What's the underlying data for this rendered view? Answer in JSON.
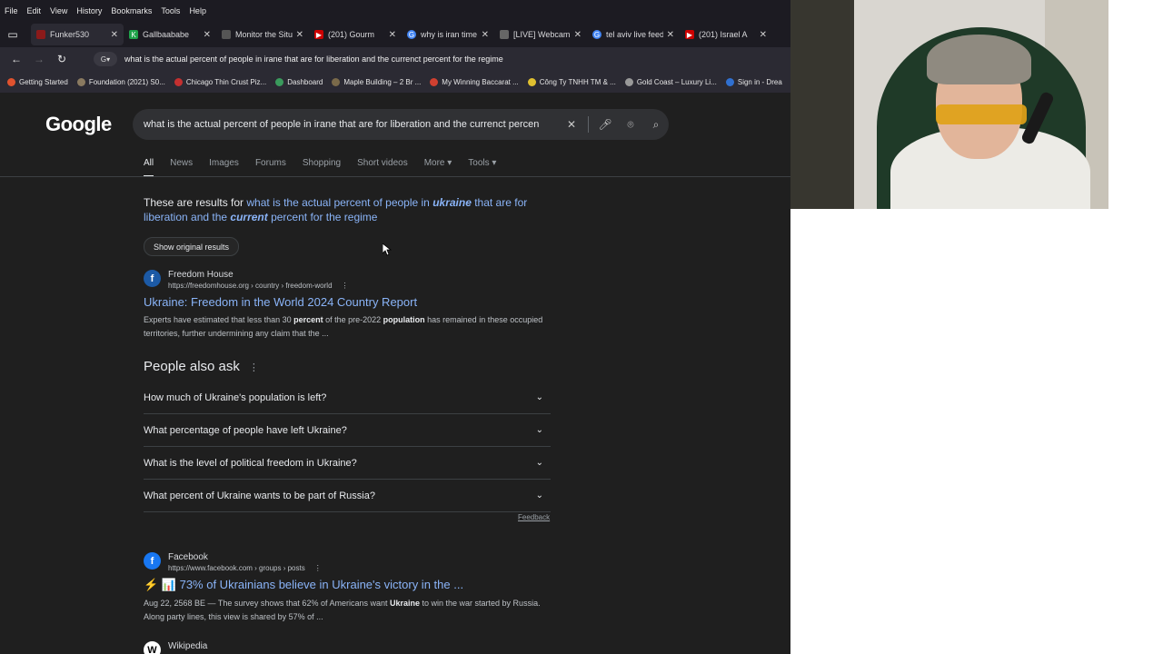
{
  "menu": [
    "File",
    "Edit",
    "View",
    "History",
    "Bookmarks",
    "Tools",
    "Help"
  ],
  "tabs": [
    {
      "title": "Funker530",
      "color": "#8b1a1a",
      "icon": "F"
    },
    {
      "title": "Gallbaababe",
      "color": "#1fa34a",
      "icon": "K"
    },
    {
      "title": "Monitor the Situa",
      "color": "#555555",
      "icon": "◉"
    },
    {
      "title": "(201) Gourm",
      "color": "#cc0000",
      "icon": "▶"
    },
    {
      "title": "why is iran time",
      "color": "#4285f4",
      "icon": "G"
    },
    {
      "title": "[LIVE] Webcam",
      "color": "#666666",
      "icon": "▦"
    },
    {
      "title": "tel aviv live feed",
      "color": "#4285f4",
      "icon": "G"
    },
    {
      "title": "(201) Israel A",
      "color": "#cc0000",
      "icon": "▶"
    }
  ],
  "url": "what is the actual percent of people in irane that are for liberation and the currenct percent for the regime",
  "bookmarks": [
    {
      "label": "Getting Started",
      "color": "#e0522e"
    },
    {
      "label": "Foundation (2021) S0...",
      "color": "#8a7a60"
    },
    {
      "label": "Chicago Thin Crust Piz...",
      "color": "#c43030"
    },
    {
      "label": "Dashboard",
      "color": "#3a9a5c"
    },
    {
      "label": "Maple Building – 2 Br ...",
      "color": "#7a6a4a"
    },
    {
      "label": "My Winning Baccarat ...",
      "color": "#d04030"
    },
    {
      "label": "Công Ty TNHH TM & ...",
      "color": "#e0c030"
    },
    {
      "label": "Gold Coast – Luxury Li...",
      "color": "#999999"
    },
    {
      "label": "Sign in - Drea",
      "color": "#3070d0"
    }
  ],
  "google": {
    "logo": "Google",
    "query": "what is the actual percent of people in irane that are for liberation and the currenct percen",
    "filters": [
      "All",
      "News",
      "Images",
      "Forums",
      "Shopping",
      "Short videos",
      "More ▾",
      "Tools ▾"
    ],
    "spell_prefix": "These are results for ",
    "spell_link_1": "what is the actual percent of people in ",
    "spell_em_1": "ukraine",
    "spell_link_2": " that are for liberation and the ",
    "spell_em_2": "current",
    "spell_link_3": " percent for the regime",
    "show_original": "Show original results",
    "result1": {
      "site": "Freedom House",
      "url": "https://freedomhouse.org › country › freedom-world",
      "title": "Ukraine: Freedom in the World 2024 Country Report",
      "snippet_1": "Experts have estimated that less than 30 ",
      "snippet_b1": "percent",
      "snippet_2": " of the pre-2022 ",
      "snippet_b2": "population",
      "snippet_3": " has remained in these occupied territories, further undermining any claim that the ..."
    },
    "paa_title": "People also ask",
    "paa": [
      "How much of Ukraine's population is left?",
      "What percentage of people have left Ukraine?",
      "What is the level of political freedom in Ukraine?",
      "What percent of Ukraine wants to be part of Russia?"
    ],
    "feedback": "Feedback",
    "result2": {
      "site": "Facebook",
      "url": "https://www.facebook.com › groups › posts",
      "title": "⚡ 📊 73% of Ukrainians believe in Ukraine's victory in the ...",
      "snippet_1": "Aug 22, 2568 BE — The survey shows that 62% of Americans want ",
      "snippet_b1": "Ukraine",
      "snippet_2": " to win the war started by Russia. Along party lines, this view is shared by 57% of ..."
    },
    "result3": {
      "site": "Wikipedia"
    }
  }
}
